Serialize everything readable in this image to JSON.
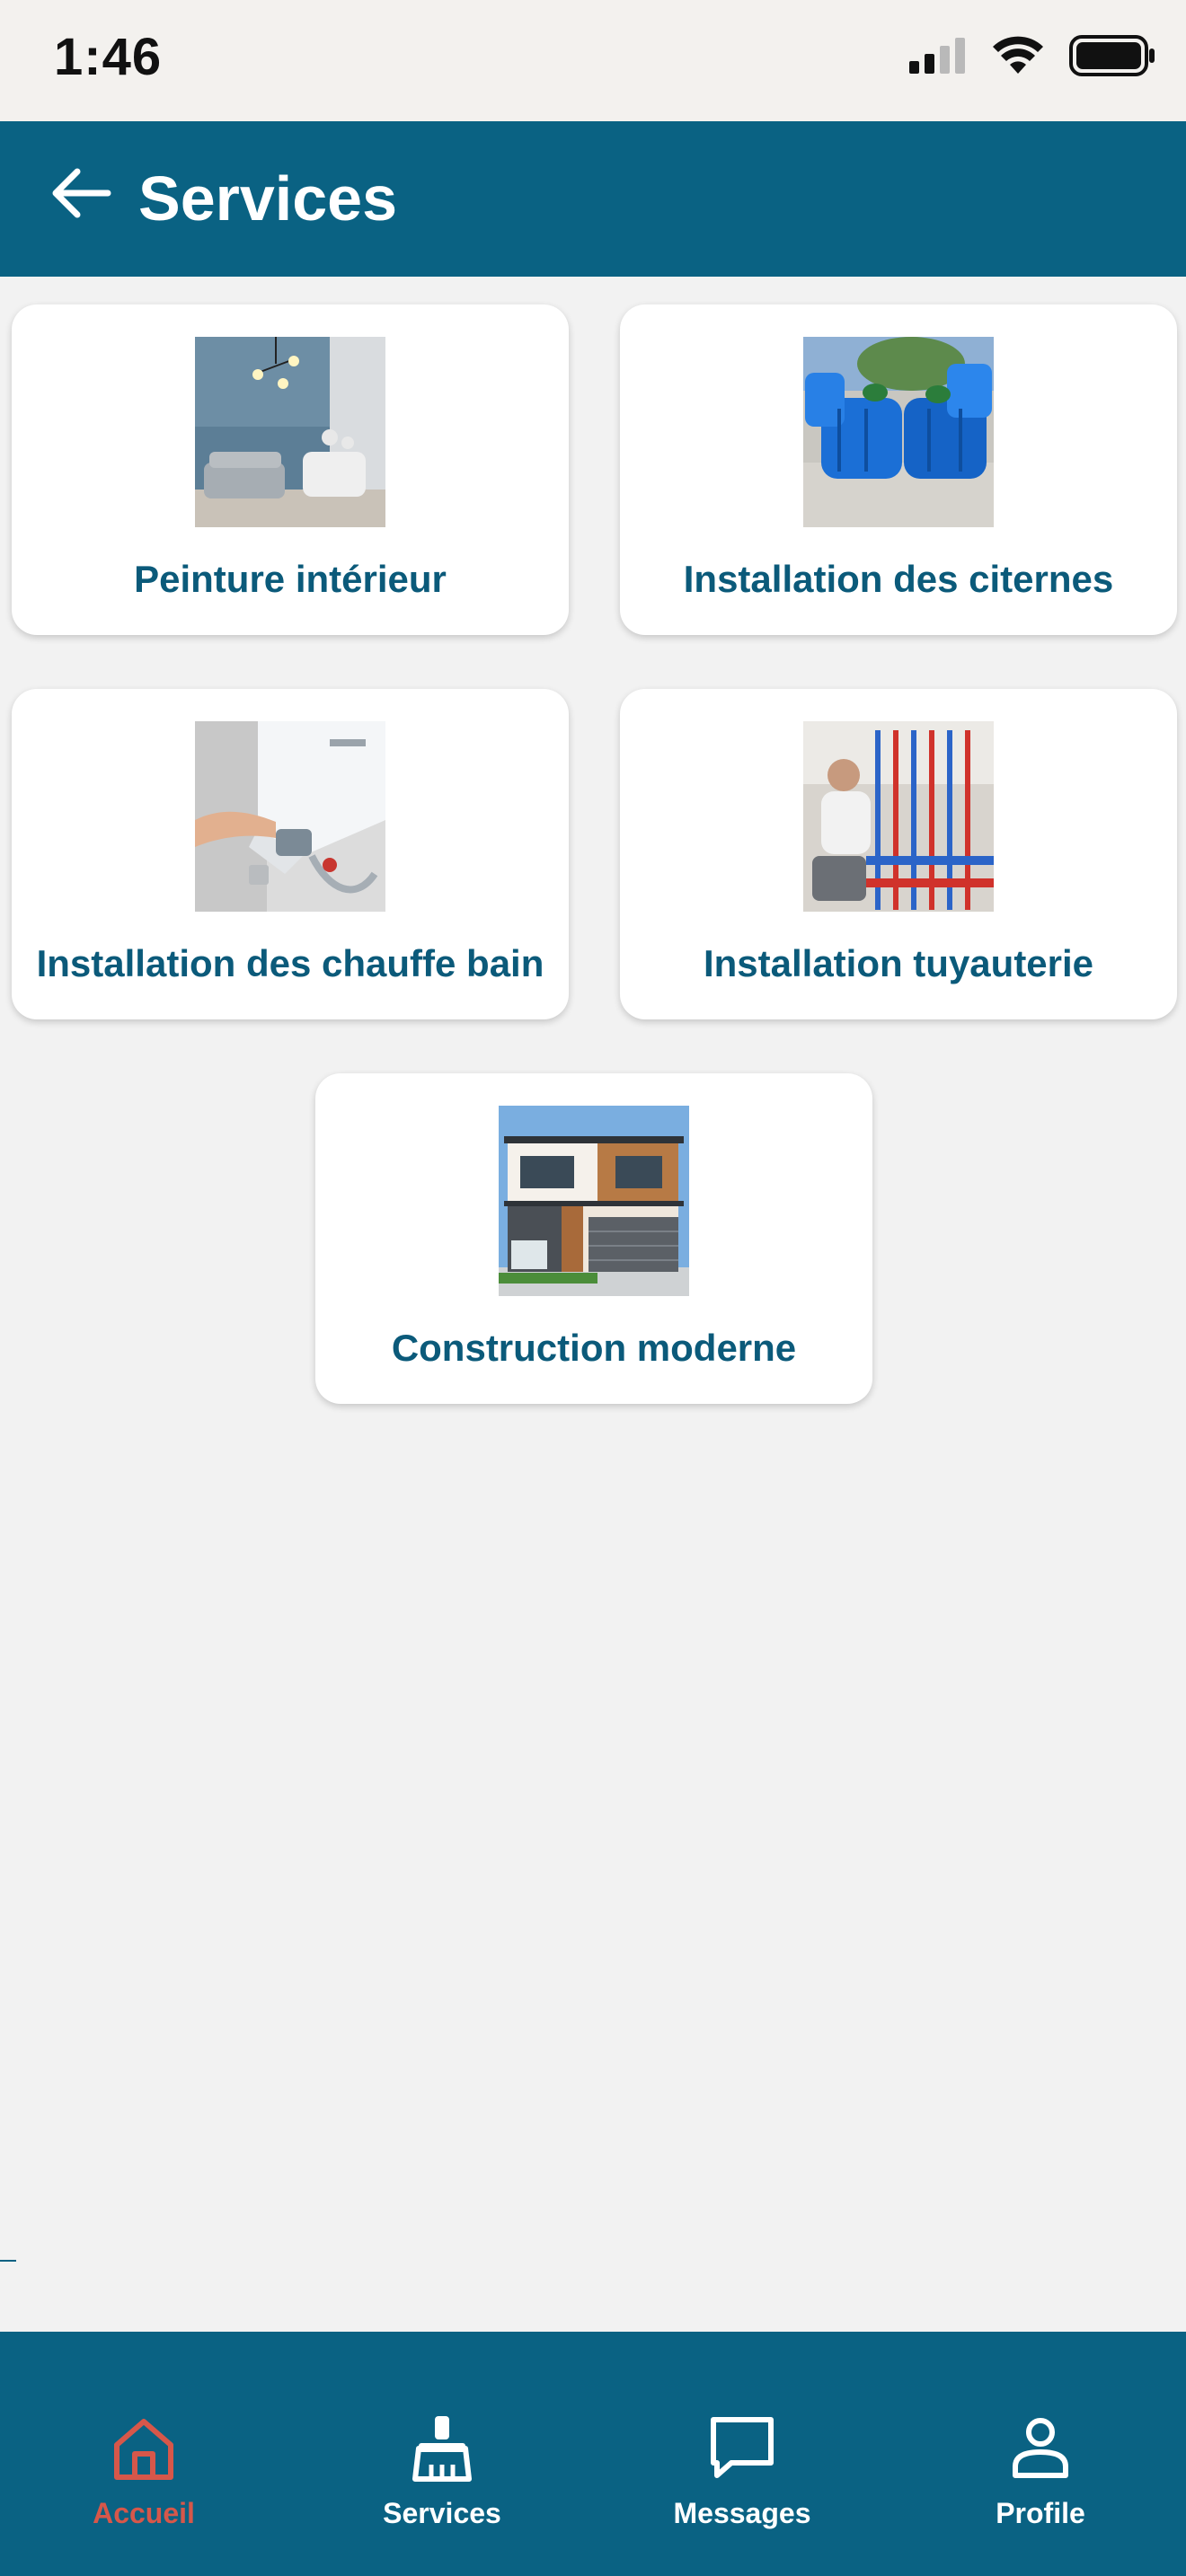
{
  "status_bar": {
    "time": "1:46"
  },
  "header": {
    "title": "Services",
    "back_icon": "arrow-left-icon"
  },
  "services": [
    {
      "label": "Peinture intérieur",
      "image": "living-room-photo"
    },
    {
      "label": "Installation des citernes",
      "image": "blue-water-tanks-photo"
    },
    {
      "label": "Installation des chauffe bain",
      "image": "water-heater-photo"
    },
    {
      "label": "Installation tuyauterie",
      "image": "plumbing-pipes-photo"
    },
    {
      "label": "Construction moderne",
      "image": "modern-house-photo"
    }
  ],
  "bottom_nav": {
    "items": [
      {
        "label": "Accueil",
        "icon": "home-icon",
        "active": true
      },
      {
        "label": "Services",
        "icon": "brush-icon",
        "active": false
      },
      {
        "label": "Messages",
        "icon": "chat-bubble-icon",
        "active": false
      },
      {
        "label": "Profile",
        "icon": "person-icon",
        "active": false
      }
    ]
  },
  "colors": {
    "primary": "#0a6283",
    "card_text": "#0b5a7a",
    "active_nav": "#d6574a",
    "background": "#f2f2f2"
  }
}
